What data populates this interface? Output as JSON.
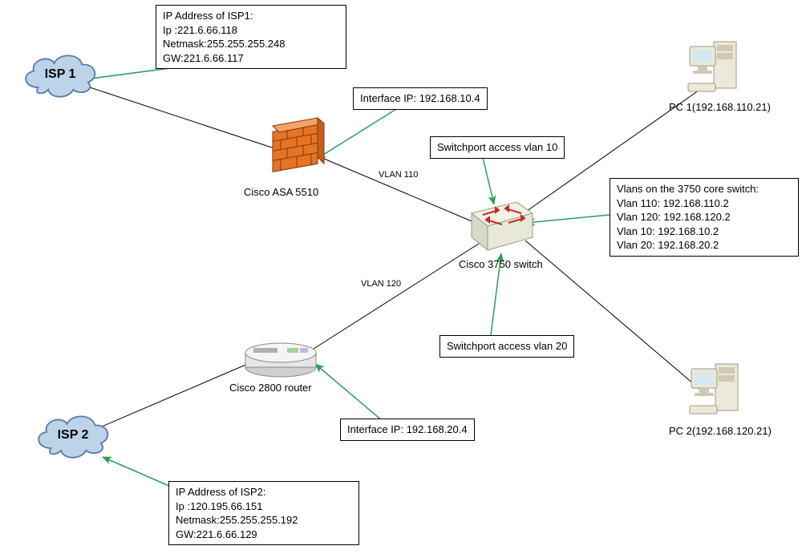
{
  "nodes": {
    "isp1": {
      "label": "ISP 1"
    },
    "isp2": {
      "label": "ISP 2"
    },
    "asa": {
      "label": "Cisco ASA 5510"
    },
    "router": {
      "label": "Cisco 2800 router"
    },
    "switch": {
      "label": "Cisco 3750 switch"
    },
    "pc1": {
      "label": "PC 1(192.168.110.21)"
    },
    "pc2": {
      "label": "PC 2(192.168.120.21)"
    }
  },
  "annotations": {
    "isp1_box": {
      "title": "IP Address of ISP1:",
      "ip": "Ip :221.6.66.118",
      "netmask": "Netmask:255.255.255.248",
      "gw": "GW:221.6.66.117"
    },
    "isp2_box": {
      "title": "IP Address of ISP2:",
      "ip": "Ip :120.195.66.151",
      "netmask": "Netmask:255.255.255.192",
      "gw": "GW:221.6.66.129"
    },
    "asa_iface": "Interface IP: 192.168.10.4",
    "router_iface": "Interface IP: 192.168.20.4",
    "vlan_access_10": "Switchport access vlan 10",
    "vlan_access_20": "Switchport access vlan 20",
    "vlan_box": {
      "title": "Vlans on the 3750 core switch:",
      "v110": "Vlan 110: 192.168.110.2",
      "v120": "Vlan 120: 192.168.120.2",
      "v10": "Vlan 10: 192.168.10.2",
      "v20": "Vlan 20: 192.168.20.2"
    }
  },
  "links": {
    "asa_switch": "VLAN 110",
    "router_switch": "VLAN 120"
  }
}
